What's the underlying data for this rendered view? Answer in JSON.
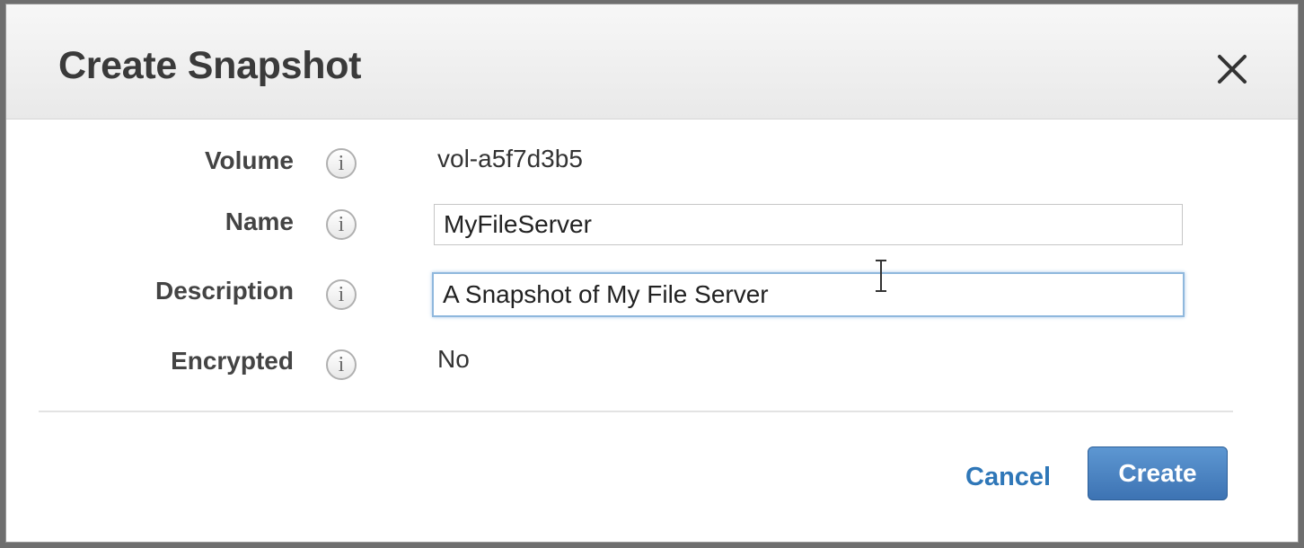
{
  "dialog": {
    "title": "Create Snapshot",
    "close_icon": "close-icon"
  },
  "fields": {
    "volume": {
      "label": "Volume",
      "value": "vol-a5f7d3b5",
      "icon": "info-icon"
    },
    "name": {
      "label": "Name",
      "value": "MyFileServer",
      "icon": "info-icon"
    },
    "description": {
      "label": "Description",
      "value": "A Snapshot of My File Server",
      "icon": "info-icon"
    },
    "encrypted": {
      "label": "Encrypted",
      "value": "No",
      "icon": "info-icon"
    }
  },
  "info_glyph": "i",
  "footer": {
    "cancel_label": "Cancel",
    "create_label": "Create"
  },
  "colors": {
    "link": "#2f77b8",
    "primary_button": "#4a83c2",
    "focus_ring": "#8fb8dd"
  }
}
